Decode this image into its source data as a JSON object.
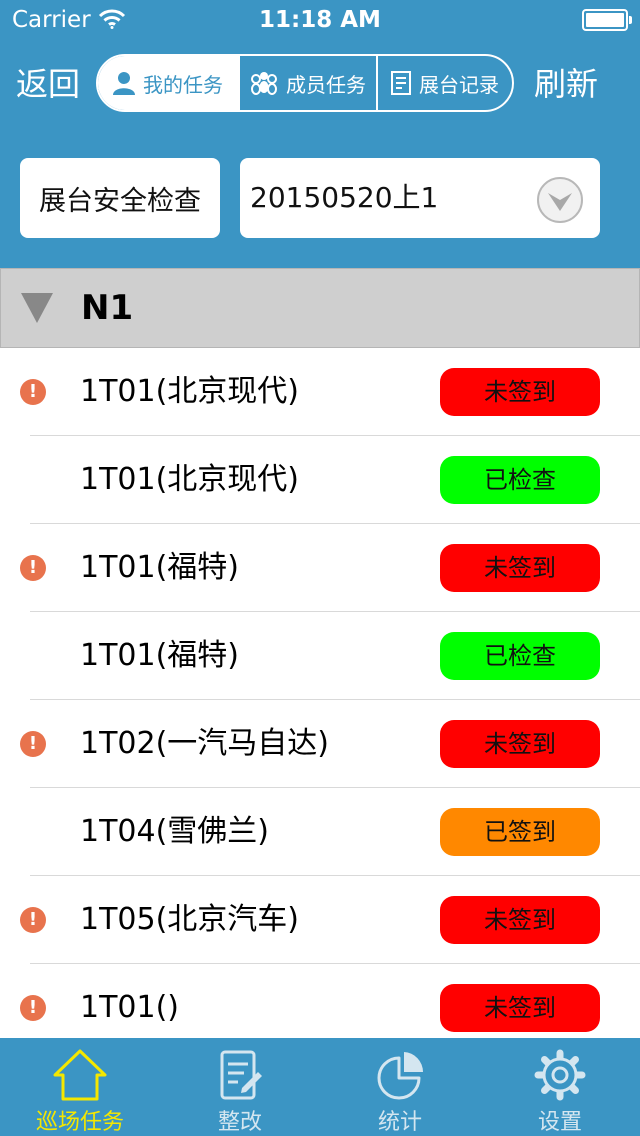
{
  "status_bar": {
    "carrier": "Carrier",
    "time": "11:18 AM"
  },
  "nav": {
    "back_label": "返回",
    "refresh_label": "刷新",
    "segments": [
      {
        "label": "我的任务",
        "icon": "person-icon",
        "active": true
      },
      {
        "label": "成员任务",
        "icon": "group-icon",
        "active": false
      },
      {
        "label": "展台记录",
        "icon": "record-icon",
        "active": false
      }
    ]
  },
  "filters": {
    "task_type": "展台安全检查",
    "batch": "20150520上1"
  },
  "group": {
    "title": "N1"
  },
  "colors": {
    "accent": "#3b95c4",
    "not_signed": "#ff0000",
    "checked": "#00ff00",
    "signed": "#ff8800",
    "alert": "#e8734d",
    "tab_active": "#f5e700"
  },
  "rows": [
    {
      "label": "1T01(北京现代)",
      "status": "未签到",
      "alert": true
    },
    {
      "label": "1T01(北京现代)",
      "status": "已检查",
      "alert": false
    },
    {
      "label": "1T01(福特)",
      "status": "未签到",
      "alert": true
    },
    {
      "label": "1T01(福特)",
      "status": "已检查",
      "alert": false
    },
    {
      "label": "1T02(一汽马自达)",
      "status": "未签到",
      "alert": true
    },
    {
      "label": "1T04(雪佛兰)",
      "status": "已签到",
      "alert": false
    },
    {
      "label": "1T05(北京汽车)",
      "status": "未签到",
      "alert": true
    },
    {
      "label": "1T01()",
      "status": "未签到",
      "alert": true
    }
  ],
  "tabs": [
    {
      "label": "巡场任务",
      "icon": "house-icon",
      "active": true
    },
    {
      "label": "整改",
      "icon": "edit-document-icon",
      "active": false
    },
    {
      "label": "统计",
      "icon": "pie-chart-icon",
      "active": false
    },
    {
      "label": "设置",
      "icon": "gear-icon",
      "active": false
    }
  ]
}
